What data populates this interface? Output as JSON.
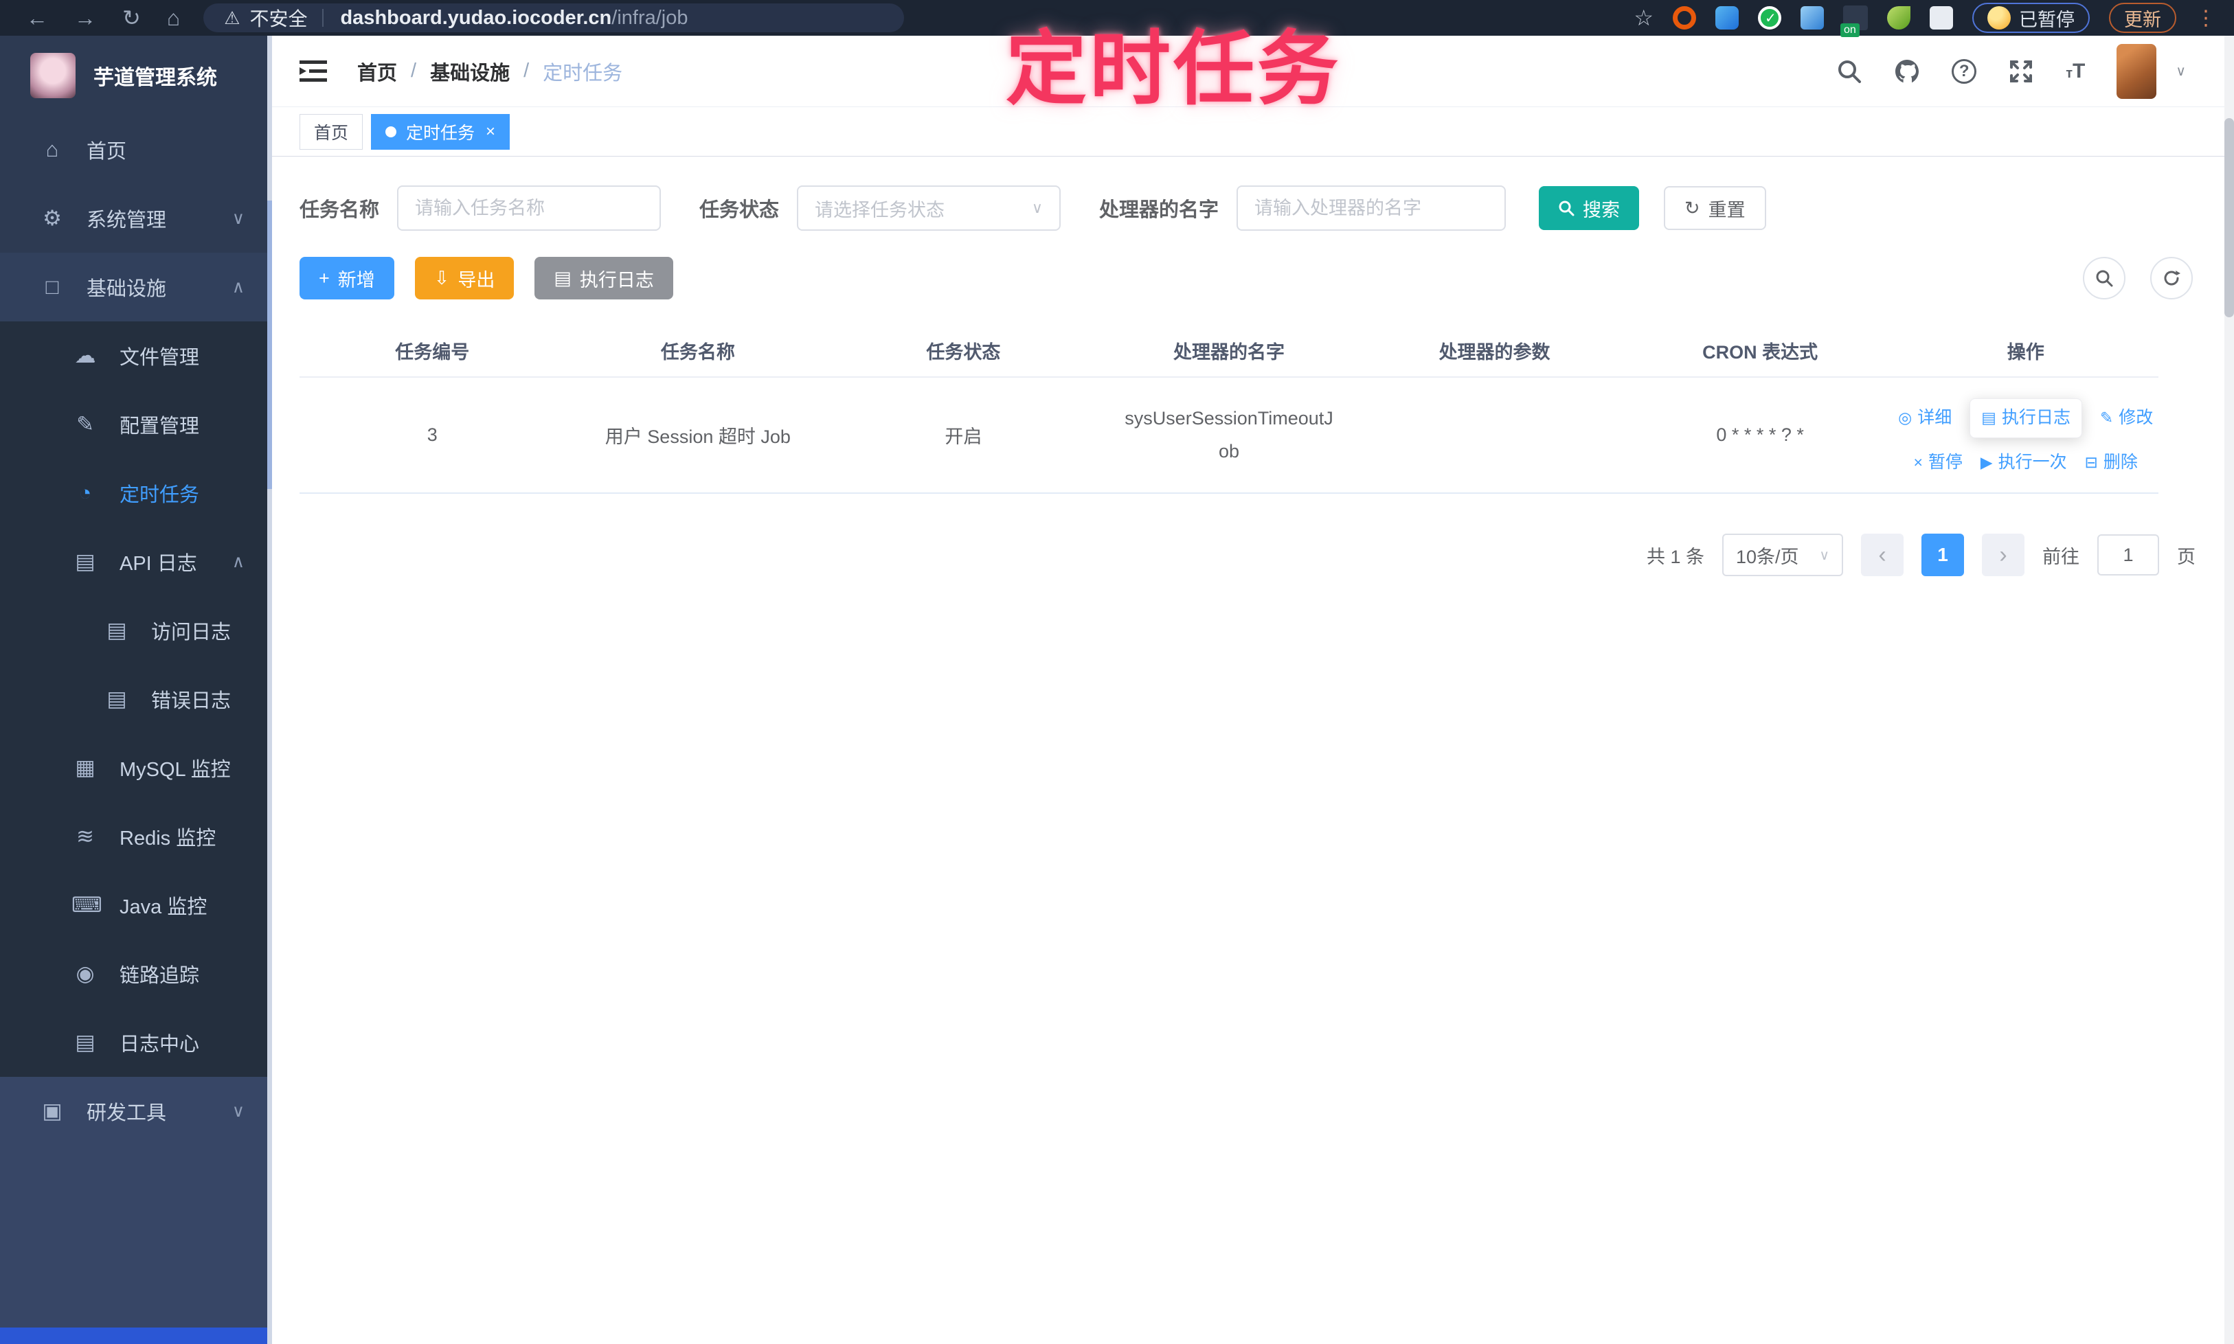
{
  "browser": {
    "security_label": "不安全",
    "url_host": "dashboard.yudao.iocoder.cn",
    "url_path": "/infra/job",
    "ext_on_label": "on",
    "paused_label": "已暂停",
    "update_label": "更新"
  },
  "annotation": {
    "text": "定时任务"
  },
  "sidebar": {
    "title": "芋道管理系统",
    "items": [
      {
        "label": "首页"
      },
      {
        "label": "系统管理"
      },
      {
        "label": "基础设施"
      },
      {
        "label": "文件管理"
      },
      {
        "label": "配置管理"
      },
      {
        "label": "定时任务"
      },
      {
        "label": "API 日志"
      },
      {
        "label": "访问日志"
      },
      {
        "label": "错误日志"
      },
      {
        "label": "MySQL 监控"
      },
      {
        "label": "Redis 监控"
      },
      {
        "label": "Java 监控"
      },
      {
        "label": "链路追踪"
      },
      {
        "label": "日志中心"
      },
      {
        "label": "研发工具"
      }
    ]
  },
  "breadcrumb": {
    "part1": "首页",
    "part2": "基础设施",
    "part3": "定时任务",
    "separator": "/"
  },
  "tabs": {
    "tab1": "首页",
    "tab2": "定时任务"
  },
  "filter": {
    "name_label": "任务名称",
    "name_placeholder": "请输入任务名称",
    "status_label": "任务状态",
    "status_placeholder": "请选择任务状态",
    "handler_label": "处理器的名字",
    "handler_placeholder": "请输入处理器的名字",
    "search_label": "搜索",
    "reset_label": "重置"
  },
  "toolbar": {
    "add": "新增",
    "export": "导出",
    "exec_log": "执行日志"
  },
  "table": {
    "columns": [
      "任务编号",
      "任务名称",
      "任务状态",
      "处理器的名字",
      "处理器的参数",
      "CRON 表达式",
      "操作"
    ],
    "row": {
      "id": "3",
      "name": "用户 Session 超时 Job",
      "status": "开启",
      "handler": "sysUserSessionTimeoutJob",
      "param": "",
      "cron": "0 * * * * ? *",
      "action_detail": "详细",
      "action_log": "执行日志",
      "action_edit": "修改",
      "action_pause": "暂停",
      "action_run_once": "执行一次",
      "action_delete": "删除"
    }
  },
  "pagination": {
    "total": "共 1 条",
    "page_size": "10条/页",
    "page": "1",
    "prev": "‹",
    "next": "›",
    "goto": "前往",
    "goto_value": "1",
    "unit": "页"
  },
  "colors": {
    "accent": "#409eff",
    "search": "#12afa0",
    "export": "#f6a21e",
    "annotation": "#f4365f"
  },
  "icons": {
    "back": "←",
    "forward": "→",
    "reload": "↻",
    "home": "⌂",
    "warning": "⚠",
    "star": "☆",
    "kebab": "⋮",
    "help": "?",
    "caret": "∨",
    "chevron_down": "∨",
    "chevron_up": "∧",
    "menu_home": "⌂",
    "menu_system": "⚙",
    "menu_infra": "□",
    "menu_file": "☁",
    "menu_config": "✎",
    "menu_job": "◔",
    "menu_api": "▤",
    "menu_access": "▤",
    "menu_error": "▤",
    "menu_mysql": "▦",
    "menu_redis": "≋",
    "menu_java": "⌨",
    "menu_trace": "◉",
    "menu_log": "▤",
    "menu_tool": "▣",
    "plus": "+",
    "download": "⇩",
    "list": "▤",
    "reset": "↻",
    "act_detail": "◎",
    "act_log": "▤",
    "act_edit": "✎",
    "act_pause": "×",
    "act_run": "▶",
    "act_delete": "⊟",
    "tab_close": "×",
    "tsize_small": "т",
    "tsize_big": "T"
  }
}
